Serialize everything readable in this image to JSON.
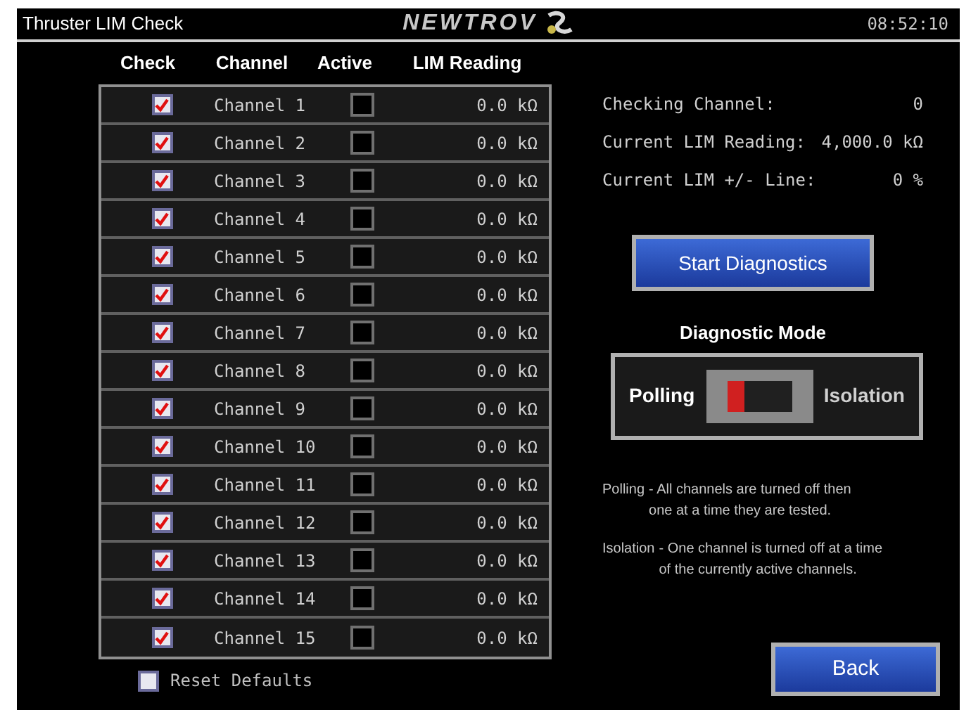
{
  "header": {
    "title": "Thruster LIM Check",
    "logo": "NEWTROV",
    "time": "08:52:10"
  },
  "table": {
    "columns": [
      "Check",
      "Channel",
      "Active",
      "LIM Reading"
    ],
    "rows": [
      {
        "checked": true,
        "channel": "Channel 1",
        "active": false,
        "reading": "0.0 kΩ"
      },
      {
        "checked": true,
        "channel": "Channel 2",
        "active": false,
        "reading": "0.0 kΩ"
      },
      {
        "checked": true,
        "channel": "Channel 3",
        "active": false,
        "reading": "0.0 kΩ"
      },
      {
        "checked": true,
        "channel": "Channel 4",
        "active": false,
        "reading": "0.0 kΩ"
      },
      {
        "checked": true,
        "channel": "Channel 5",
        "active": false,
        "reading": "0.0 kΩ"
      },
      {
        "checked": true,
        "channel": "Channel 6",
        "active": false,
        "reading": "0.0 kΩ"
      },
      {
        "checked": true,
        "channel": "Channel 7",
        "active": false,
        "reading": "0.0 kΩ"
      },
      {
        "checked": true,
        "channel": "Channel 8",
        "active": false,
        "reading": "0.0 kΩ"
      },
      {
        "checked": true,
        "channel": "Channel 9",
        "active": false,
        "reading": "0.0 kΩ"
      },
      {
        "checked": true,
        "channel": "Channel 10",
        "active": false,
        "reading": "0.0 kΩ"
      },
      {
        "checked": true,
        "channel": "Channel 11",
        "active": false,
        "reading": "0.0 kΩ"
      },
      {
        "checked": true,
        "channel": "Channel 12",
        "active": false,
        "reading": "0.0 kΩ"
      },
      {
        "checked": true,
        "channel": "Channel 13",
        "active": false,
        "reading": "0.0 kΩ"
      },
      {
        "checked": true,
        "channel": "Channel 14",
        "active": false,
        "reading": "0.0 kΩ"
      },
      {
        "checked": true,
        "channel": "Channel 15",
        "active": false,
        "reading": "0.0 kΩ"
      }
    ]
  },
  "reset_defaults": {
    "label": "Reset Defaults",
    "checked": false
  },
  "status": [
    {
      "label": "Checking Channel:",
      "value": "0"
    },
    {
      "label": "Current LIM Reading:",
      "value": "4,000.0 kΩ"
    },
    {
      "label": "Current LIM +/- Line:",
      "value": "0 %"
    }
  ],
  "start_button": "Start Diagnostics",
  "diagnostic_mode": {
    "title": "Diagnostic Mode",
    "options": [
      {
        "label": "Polling",
        "selected": true
      },
      {
        "label": "Isolation",
        "selected": false
      }
    ]
  },
  "notes": [
    {
      "term": "Polling",
      "text": "- All channels are turned off then one at a time they are tested."
    },
    {
      "term": "Isolation",
      "text": "- One channel is turned off at a time of the currently active channels."
    }
  ],
  "back_button": "Back"
}
